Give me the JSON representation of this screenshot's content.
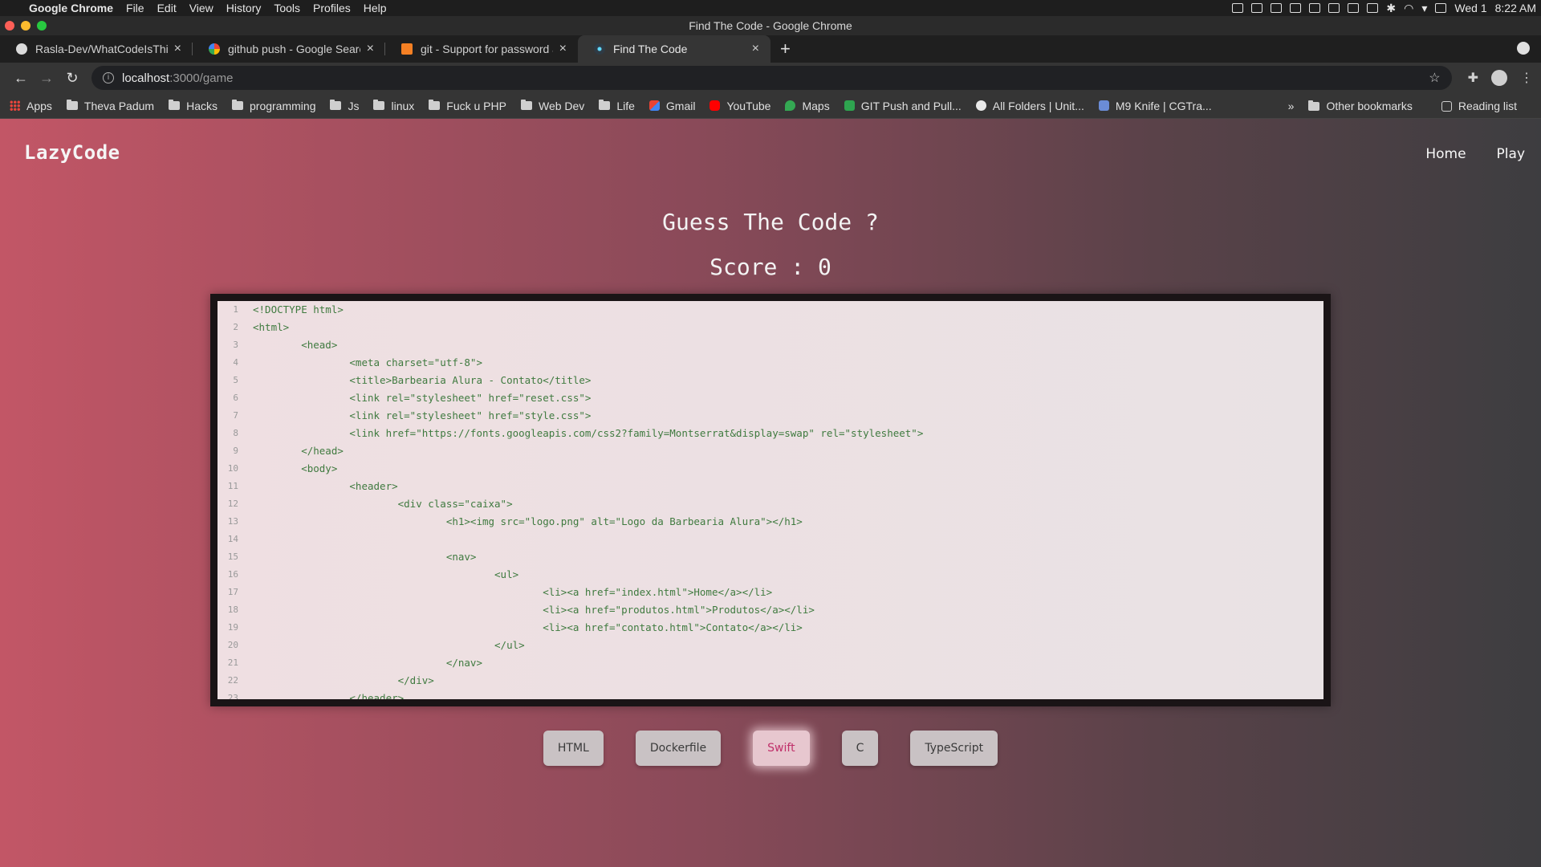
{
  "menubar": {
    "app": "Google Chrome",
    "items": [
      "File",
      "Edit",
      "View",
      "History",
      "Tools",
      "Profiles",
      "Help"
    ],
    "date": "Wed 1",
    "time": "8:22 AM"
  },
  "window": {
    "title": "Find The Code - Google Chrome"
  },
  "tabs": [
    {
      "title": "Rasla-Dev/WhatCodeIsThis: A",
      "favicon": "github-icon",
      "active": false
    },
    {
      "title": "github push - Google Search",
      "favicon": "google-icon",
      "active": false
    },
    {
      "title": "git - Support for password au",
      "favicon": "stackoverflow-icon",
      "active": false
    },
    {
      "title": "Find The Code",
      "favicon": "react-icon",
      "active": true
    }
  ],
  "toolbar": {
    "url_host": "localhost",
    "url_path": ":3000/game"
  },
  "bookmarks": {
    "items": [
      {
        "label": "Apps",
        "icon": "apps-grid-icon"
      },
      {
        "label": "Theva Padum",
        "icon": "folder-icon"
      },
      {
        "label": "Hacks",
        "icon": "folder-icon"
      },
      {
        "label": "programming",
        "icon": "folder-icon"
      },
      {
        "label": "Js",
        "icon": "folder-icon"
      },
      {
        "label": "linux",
        "icon": "folder-icon"
      },
      {
        "label": "Fuck u PHP",
        "icon": "folder-icon"
      },
      {
        "label": "Web Dev",
        "icon": "folder-icon"
      },
      {
        "label": "Life",
        "icon": "folder-icon"
      },
      {
        "label": "Gmail",
        "icon": "gmail-icon"
      },
      {
        "label": "YouTube",
        "icon": "youtube-icon"
      },
      {
        "label": "Maps",
        "icon": "maps-icon"
      },
      {
        "label": "GIT Push and Pull...",
        "icon": "site-icon"
      },
      {
        "label": "All Folders | Unit...",
        "icon": "site-icon"
      },
      {
        "label": "M9 Knife | CGTra...",
        "icon": "site-icon"
      }
    ],
    "more": "»",
    "other": "Other bookmarks",
    "reading_list": "Reading list"
  },
  "page": {
    "logo": "LazyCode",
    "nav": [
      "Home",
      "Play"
    ],
    "heading": "Guess The Code ?",
    "score_label": "Score :",
    "score_value": "0",
    "code_lines": [
      "<!DOCTYPE html>",
      "<html>",
      "\t<head>",
      "\t\t<meta charset=\"utf-8\">",
      "\t\t<title>Barbearia Alura - Contato</title>",
      "\t\t<link rel=\"stylesheet\" href=\"reset.css\">",
      "\t\t<link rel=\"stylesheet\" href=\"style.css\">",
      "\t\t<link href=\"https://fonts.googleapis.com/css2?family=Montserrat&display=swap\" rel=\"stylesheet\">",
      "\t</head>",
      "\t<body>",
      "\t\t<header>",
      "\t\t\t<div class=\"caixa\">",
      "\t\t\t\t<h1><img src=\"logo.png\" alt=\"Logo da Barbearia Alura\"></h1>",
      "",
      "\t\t\t\t<nav>",
      "\t\t\t\t\t<ul>",
      "\t\t\t\t\t\t<li><a href=\"index.html\">Home</a></li>",
      "\t\t\t\t\t\t<li><a href=\"produtos.html\">Produtos</a></li>",
      "\t\t\t\t\t\t<li><a href=\"contato.html\">Contato</a></li>",
      "\t\t\t\t\t</ul>",
      "\t\t\t\t</nav>",
      "\t\t\t</div>",
      "\t\t</header>"
    ],
    "answers": [
      {
        "label": "HTML",
        "selected": false
      },
      {
        "label": "Dockerfile",
        "selected": false
      },
      {
        "label": "Swift",
        "selected": true
      },
      {
        "label": "C",
        "selected": false
      },
      {
        "label": "TypeScript",
        "selected": false
      }
    ]
  }
}
